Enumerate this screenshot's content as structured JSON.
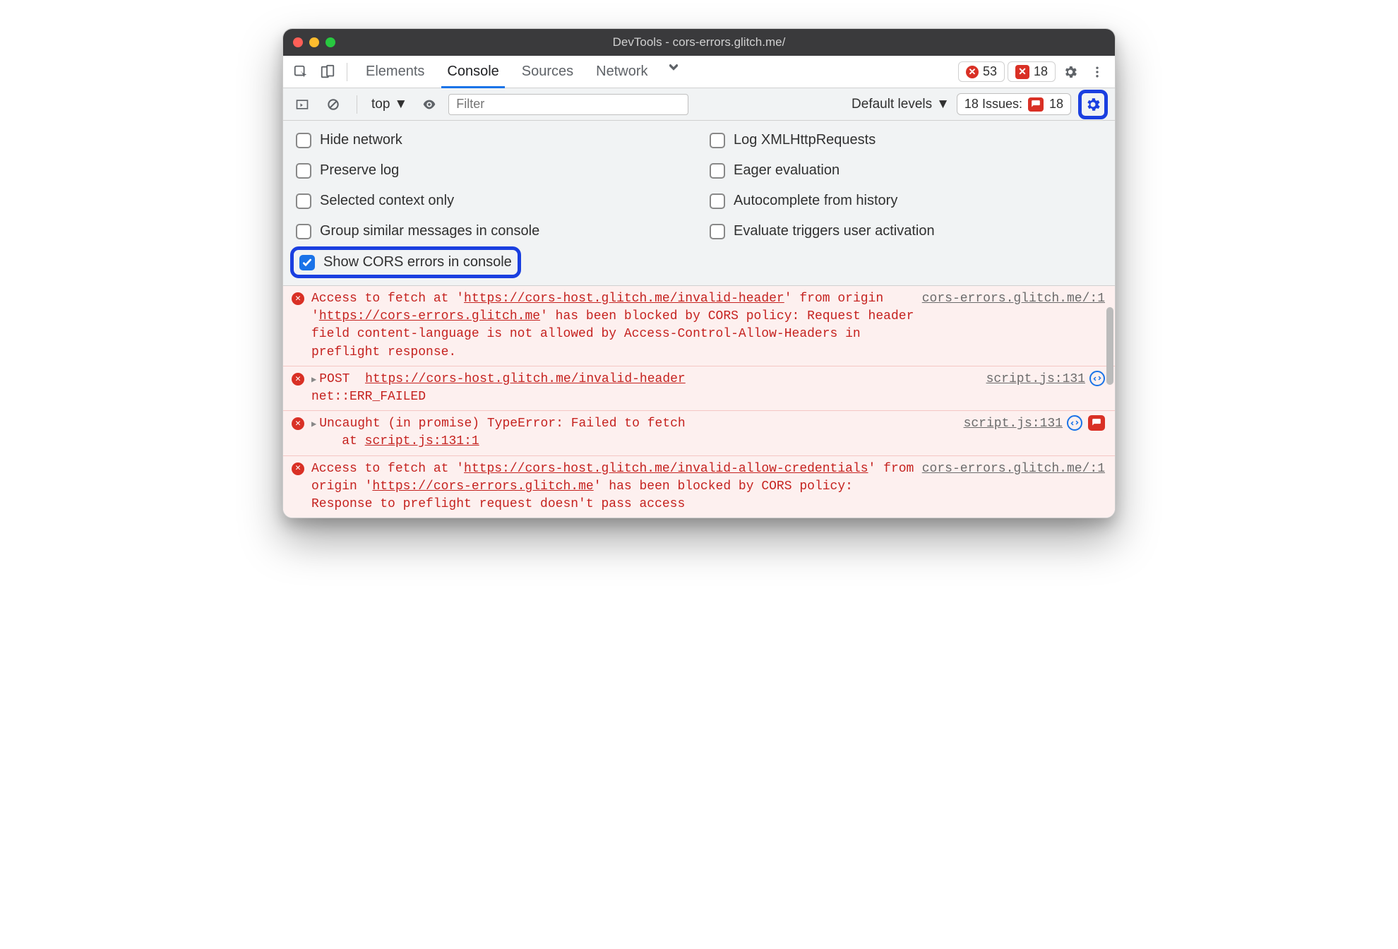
{
  "titlebar": {
    "title": "DevTools - cors-errors.glitch.me/"
  },
  "tabs": {
    "items": [
      "Elements",
      "Console",
      "Sources",
      "Network"
    ],
    "active_index": 1
  },
  "toolbar": {
    "error_count": "53",
    "issue_count": "18"
  },
  "subtoolbar": {
    "context": "top",
    "filter_placeholder": "Filter",
    "levels": "Default levels",
    "issues_label": "18 Issues:",
    "issues_badge": "18"
  },
  "settings": {
    "left": [
      {
        "label": "Hide network",
        "checked": false
      },
      {
        "label": "Preserve log",
        "checked": false
      },
      {
        "label": "Selected context only",
        "checked": false
      },
      {
        "label": "Group similar messages in console",
        "checked": false
      },
      {
        "label": "Show CORS errors in console",
        "checked": true,
        "highlight": true
      }
    ],
    "right": [
      {
        "label": "Log XMLHttpRequests",
        "checked": false
      },
      {
        "label": "Eager evaluation",
        "checked": false
      },
      {
        "label": "Autocomplete from history",
        "checked": false
      },
      {
        "label": "Evaluate triggers user activation",
        "checked": false
      }
    ]
  },
  "logs": [
    {
      "type": "cors",
      "source": "cors-errors.glitch.me/:1",
      "msg_pre": "Access to fetch at '",
      "url1": "https://cors-host.glitch.me/invalid-header",
      "msg_mid": "' from origin '",
      "url2": "https://cors-errors.glitch.me",
      "msg_post": "' has been blocked by CORS policy: Request header field content-language is not allowed by Access-Control-Allow-Headers in preflight response."
    },
    {
      "type": "net",
      "method": "POST",
      "url": "https://cors-host.glitch.me/invalid-header",
      "status": "net::ERR_FAILED",
      "source": "script.js:131"
    },
    {
      "type": "uncaught",
      "msg": "Uncaught (in promise) TypeError: Failed to fetch",
      "stack_label": "at",
      "stack": "script.js:131:1",
      "source": "script.js:131"
    },
    {
      "type": "cors",
      "source": "cors-errors.glitch.me/:1",
      "msg_pre": "Access to fetch at '",
      "url1": "https://cors-host.glitch.me/invalid-allow-credentials",
      "msg_mid": "' from origin '",
      "url2": "https://cors-errors.glitch.me",
      "msg_post": "' has been blocked by CORS policy: Response to preflight request doesn't pass access"
    }
  ]
}
